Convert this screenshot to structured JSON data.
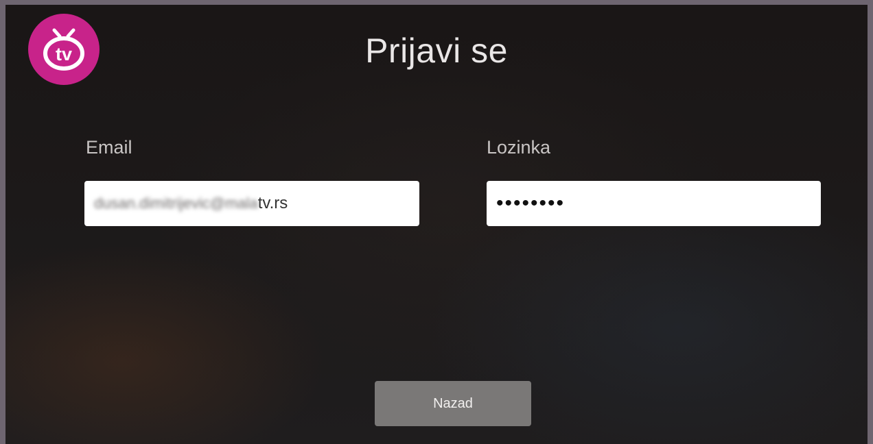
{
  "header": {
    "logo_icon": "tv-logo-icon",
    "logo_text": "tv",
    "brand_color": "#c8238a",
    "title": "Prijavi se"
  },
  "form": {
    "email": {
      "label": "Email",
      "value_obscured": "dusan.dimitrijevic@mala",
      "value_visible_suffix": "tv.rs"
    },
    "password": {
      "label": "Lozinka",
      "value": "••••••••"
    }
  },
  "actions": {
    "back_label": "Nazad"
  }
}
